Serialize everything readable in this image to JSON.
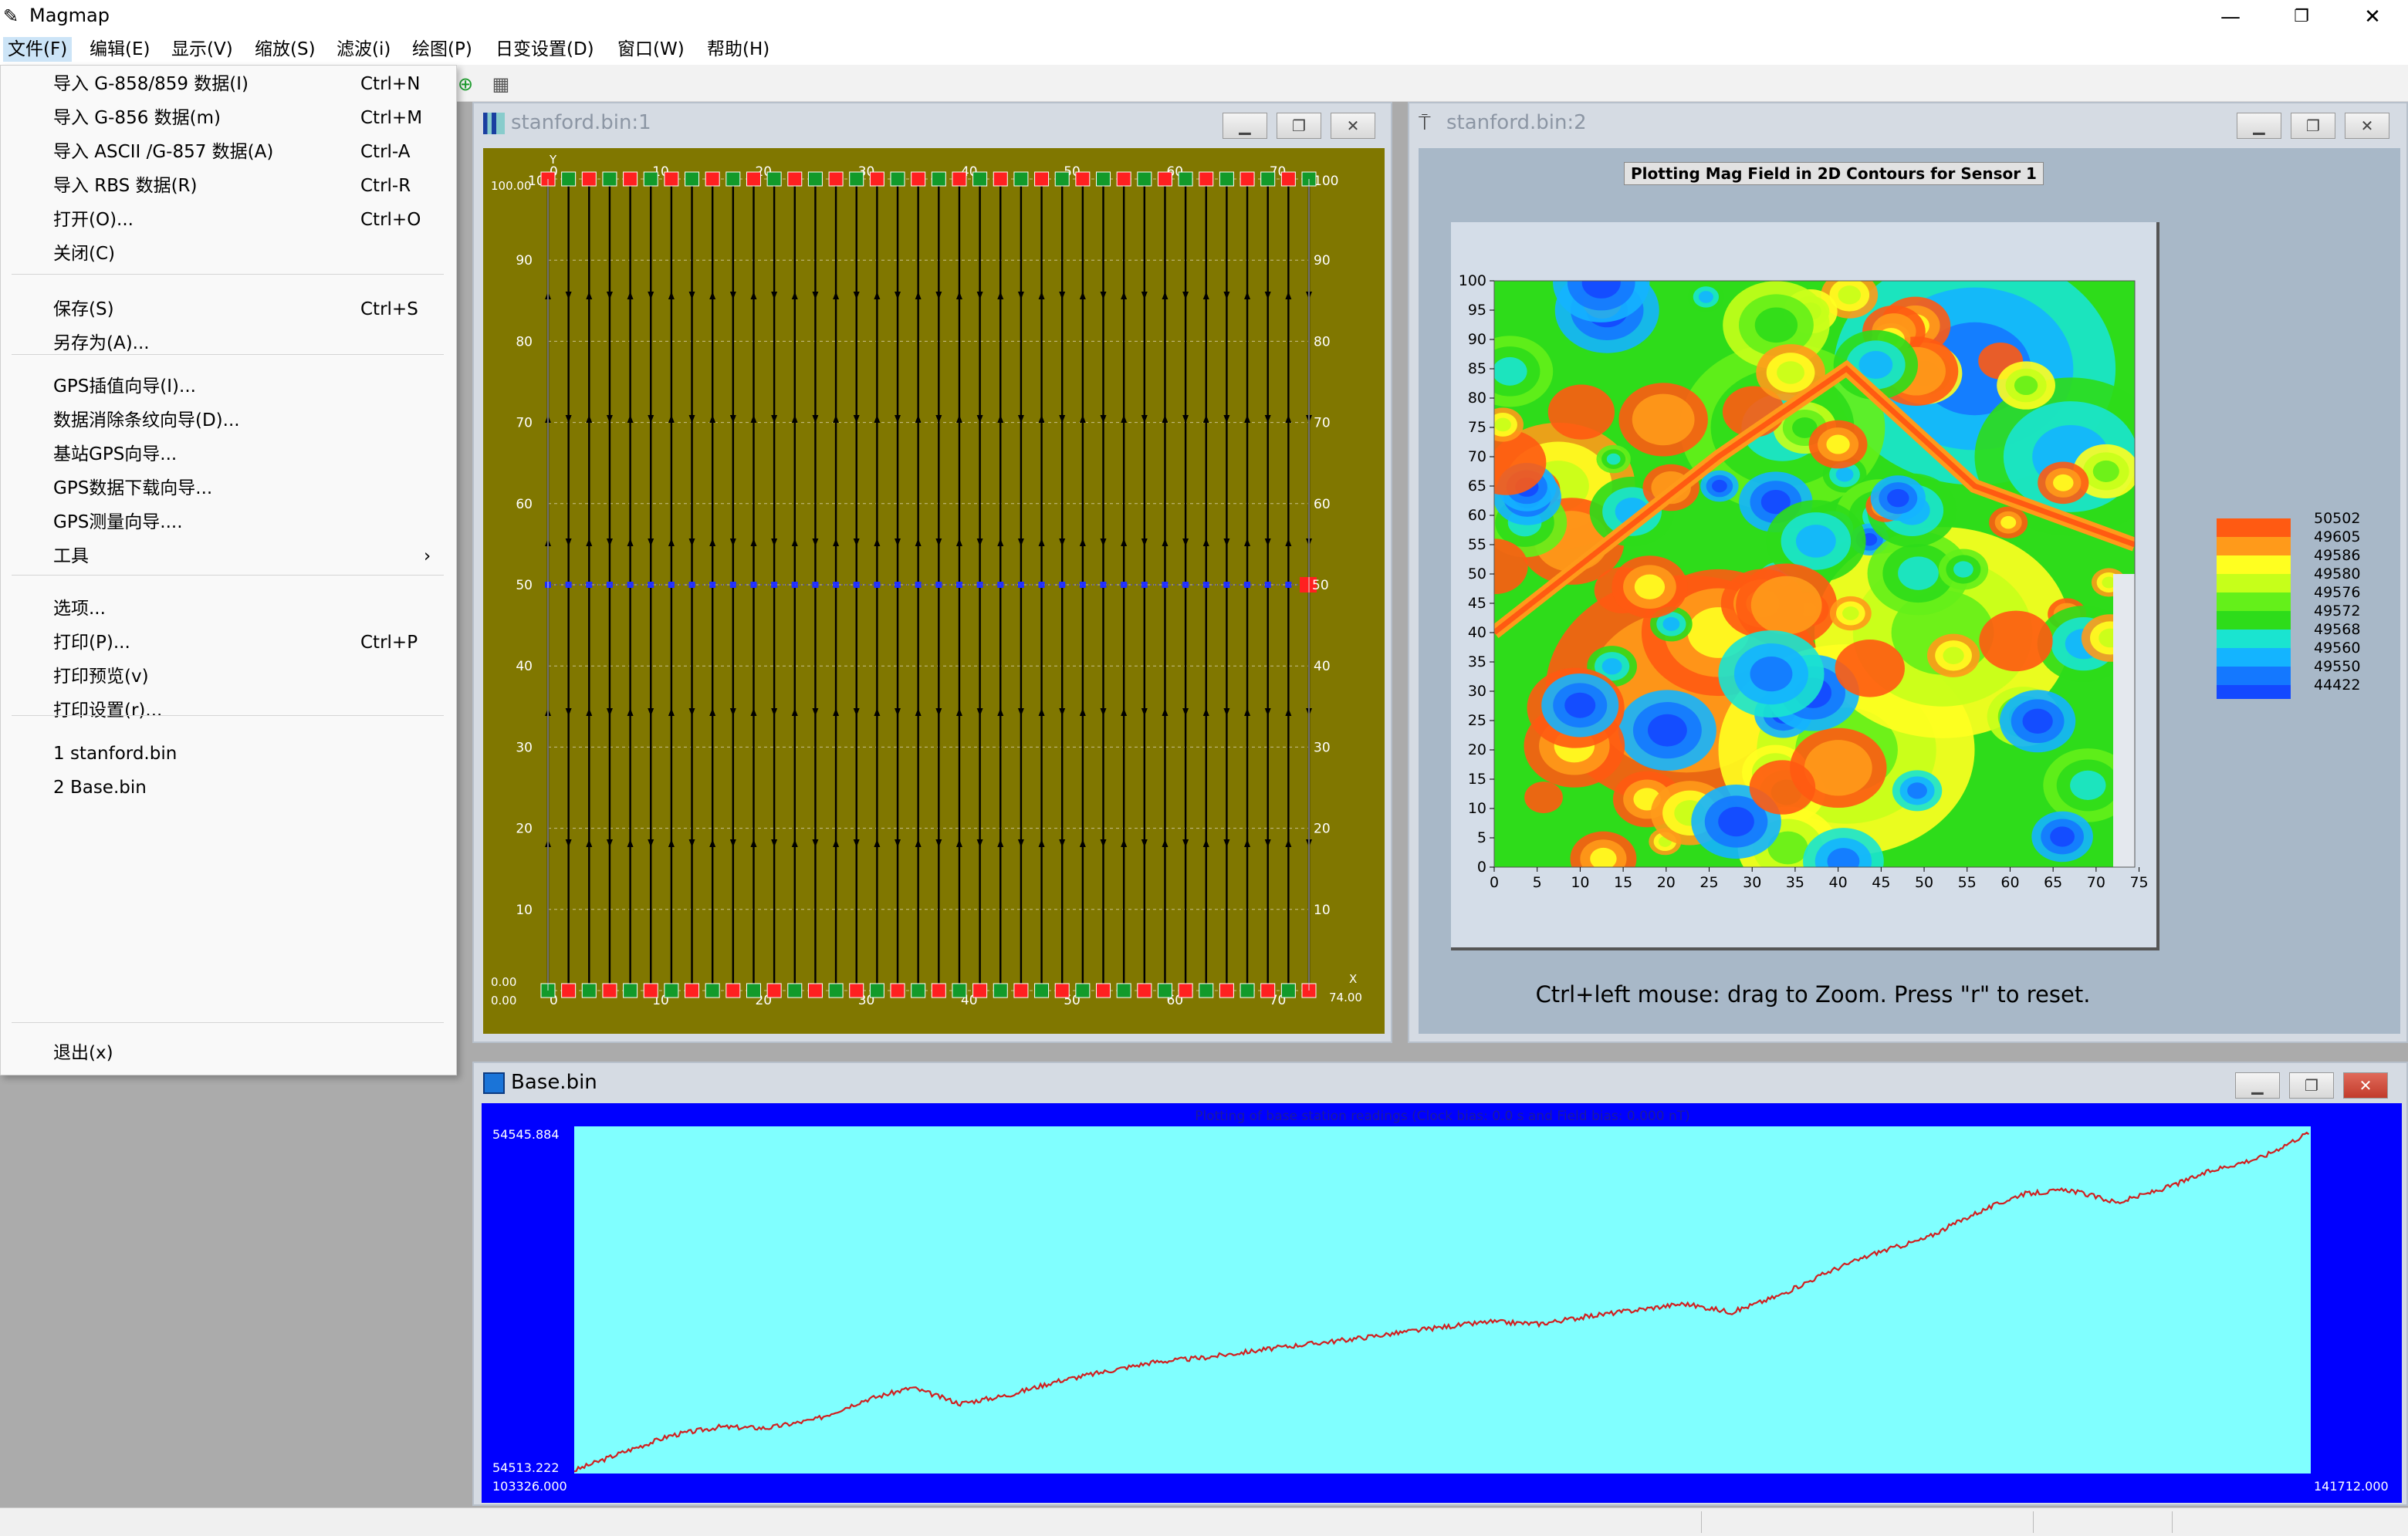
{
  "app": {
    "title": "Magmap",
    "minimize": "—",
    "restore": "❐",
    "close": "✕"
  },
  "menubar": [
    "文件(F)",
    "编辑(E)",
    "显示(V)",
    "缩放(S)",
    "滤波(i)",
    "绘图(P)",
    "日变设置(D)",
    "窗口(W)",
    "帮助(H)"
  ],
  "file_menu": {
    "items": [
      {
        "label": "导入 G-858/859 数据(I)",
        "shortcut": "Ctrl+N"
      },
      {
        "label": "导入 G-856 数据(m)",
        "shortcut": "Ctrl+M"
      },
      {
        "label": "导入 ASCII /G-857 数据(A)",
        "shortcut": "Ctrl-A"
      },
      {
        "label": "导入 RBS 数据(R)",
        "shortcut": "Ctrl-R"
      },
      {
        "label": "打开(O)...",
        "shortcut": "Ctrl+O"
      },
      {
        "label": "关闭(C)",
        "shortcut": ""
      },
      {
        "label": "保存(S)",
        "shortcut": "Ctrl+S"
      },
      {
        "label": "另存为(A)...",
        "shortcut": ""
      },
      {
        "label": "GPS插值向导(I)...",
        "shortcut": ""
      },
      {
        "label": "数据消除条纹向导(D)...",
        "shortcut": ""
      },
      {
        "label": "基站GPS向导...",
        "shortcut": ""
      },
      {
        "label": "GPS数据下载向导...",
        "shortcut": ""
      },
      {
        "label": "GPS测量向导....",
        "shortcut": ""
      },
      {
        "label": "工具",
        "shortcut": "",
        "arrow": "›"
      },
      {
        "label": "选项...",
        "shortcut": ""
      },
      {
        "label": "打印(P)...",
        "shortcut": "Ctrl+P"
      },
      {
        "label": "打印预览(v)",
        "shortcut": ""
      },
      {
        "label": "打印设置(r)...",
        "shortcut": ""
      },
      {
        "label": "1 stanford.bin",
        "shortcut": ""
      },
      {
        "label": "2 Base.bin",
        "shortcut": ""
      },
      {
        "label": "退出(x)",
        "shortcut": ""
      }
    ]
  },
  "windows": {
    "w1": {
      "title": "stanford.bin:1"
    },
    "w2": {
      "title": "stanford.bin:2",
      "plot_title": "Plotting Mag Field in 2D Contours for Sensor 1",
      "hint": "Ctrl+left mouse: drag to Zoom. Press \"r\" to reset."
    },
    "w3": {
      "title": "Base.bin"
    }
  },
  "track_plot": {
    "y_axis_label": "Y",
    "x_axis_label": "X",
    "ymax_label": "100.00",
    "ymin_label": "0.00",
    "xmin_label": "0.00",
    "xmax_label": "74.00",
    "y_ticks": [
      "100",
      "90",
      "80",
      "70",
      "60",
      "50",
      "40",
      "30",
      "20",
      "10"
    ],
    "x_ticks": [
      "0",
      "10",
      "20",
      "30",
      "40",
      "50",
      "60",
      "70"
    ],
    "right_tick_top": "100",
    "right_tick_50": "50"
  },
  "contour_legend": [
    "50502",
    "49605",
    "49586",
    "49580",
    "49576",
    "49572",
    "49568",
    "49560",
    "49550",
    "44422"
  ],
  "contour_colors": [
    "#ff5a12",
    "#ff9a1a",
    "#ffff20",
    "#c6ff1a",
    "#64f01a",
    "#2edc1a",
    "#1ae4d0",
    "#14b4ff",
    "#1478ff",
    "#1448ff"
  ],
  "contour_axes": {
    "x_ticks": [
      "0",
      "5",
      "10",
      "15",
      "20",
      "25",
      "30",
      "35",
      "40",
      "45",
      "50",
      "55",
      "60",
      "65",
      "70",
      "75"
    ],
    "y_ticks": [
      "0",
      "5",
      "10",
      "15",
      "20",
      "25",
      "30",
      "35",
      "40",
      "45",
      "50",
      "55",
      "60",
      "65",
      "70",
      "75",
      "80",
      "85",
      "90",
      "95",
      "100"
    ]
  },
  "chart_data": {
    "type": "line",
    "title": "Plotting of base station readings (Clock bias: 0.0 s and Field bias: 0.000 nT)",
    "y_top_label": "54545.884",
    "y_bottom_label": "54513.222",
    "x_left_label": "103326.000",
    "x_right_label": "141712.000",
    "ylim": [
      54513.222,
      54545.884
    ],
    "x": [
      0,
      3,
      6,
      9,
      12,
      15,
      18,
      21,
      24,
      27,
      30,
      33,
      36,
      39,
      42,
      45,
      48,
      51,
      54,
      57,
      60,
      63,
      66,
      69,
      72,
      75,
      78,
      81,
      84,
      87,
      90,
      93,
      96,
      100
    ],
    "values": [
      54513.5,
      54515.2,
      54516.8,
      54517.6,
      54517.5,
      54518.3,
      54520.1,
      54521.3,
      54519.8,
      54520.6,
      54521.9,
      54522.8,
      54523.7,
      54524.1,
      54524.7,
      54525.3,
      54525.8,
      54526.4,
      54527.0,
      54527.5,
      54527.3,
      54528.0,
      54528.6,
      54529.2,
      54528.4,
      54530.0,
      54532.2,
      54534.0,
      54535.3,
      54537.6,
      54539.5,
      54539.9,
      54538.7,
      54540.1,
      54541.8,
      54543.0,
      54545.4
    ]
  }
}
